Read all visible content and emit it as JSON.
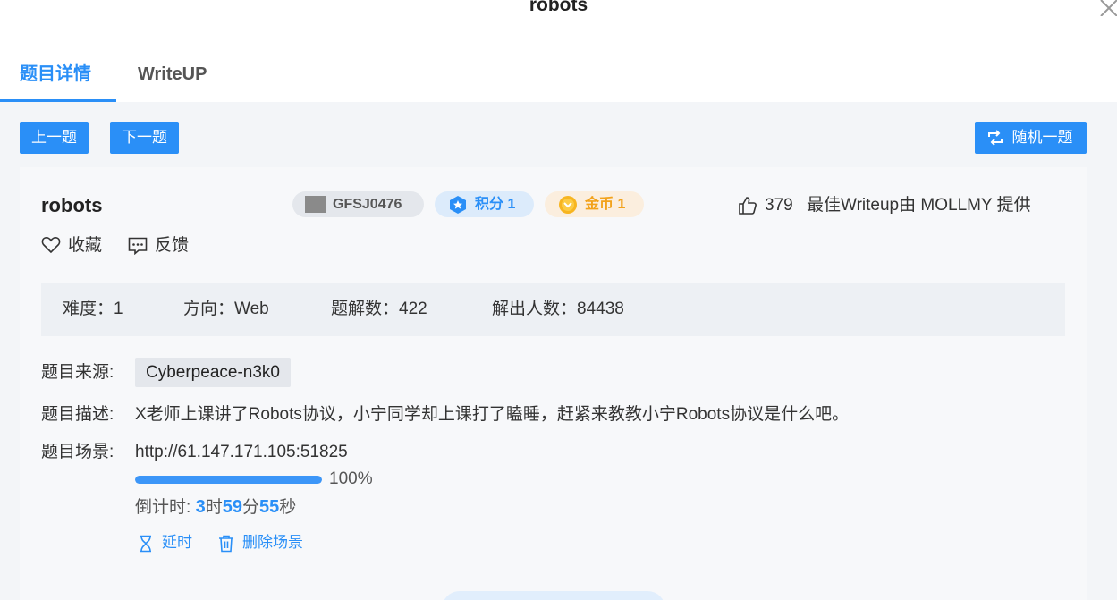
{
  "dialog": {
    "title": "robots"
  },
  "tabs": [
    {
      "label": "题目详情",
      "active": true
    },
    {
      "label": "WriteUP",
      "active": false
    }
  ],
  "nav": {
    "prev_label": "上一题",
    "next_label": "下一题",
    "random_label": "随机一题",
    "random_icon": "swap-icon"
  },
  "challenge": {
    "name": "robots",
    "id": "GFSJ0476",
    "score_label": "积分 1",
    "coin_label": "金币 1",
    "likes": "379",
    "best_writeup": "最佳Writeup由 MOLLMY 提供",
    "favorite_label": "收藏",
    "feedback_label": "反馈"
  },
  "info": {
    "difficulty": "难度：1",
    "direction": "方向：Web",
    "solutions": "题解数：422",
    "solvers": "解出人数：84438"
  },
  "meta": {
    "source_label": "题目来源:",
    "source_value": "Cyberpeace-n3k0",
    "desc_label": "题目描述:",
    "desc_value": "X老师上课讲了Robots协议，小宁同学却上课打了瞌睡，赶紧来教教小宁Robots协议是什么吧。",
    "scene_label": "题目场景:",
    "scene_url": "http://61.147.171.105:51825",
    "progress": 100,
    "progress_text": "100%"
  },
  "countdown": {
    "prefix": "倒计时: ",
    "hours": "3",
    "hours_unit": "时",
    "minutes": "59",
    "minutes_unit": "分",
    "seconds": "55",
    "seconds_unit": "秒"
  },
  "actions": {
    "delay_label": "延时",
    "delete_label": "删除场景"
  },
  "colors": {
    "accent": "#2a8ff7",
    "coin": "#f2a21b",
    "badge_score_bg": "#dcebfb",
    "badge_coin_bg": "#fbeede"
  }
}
